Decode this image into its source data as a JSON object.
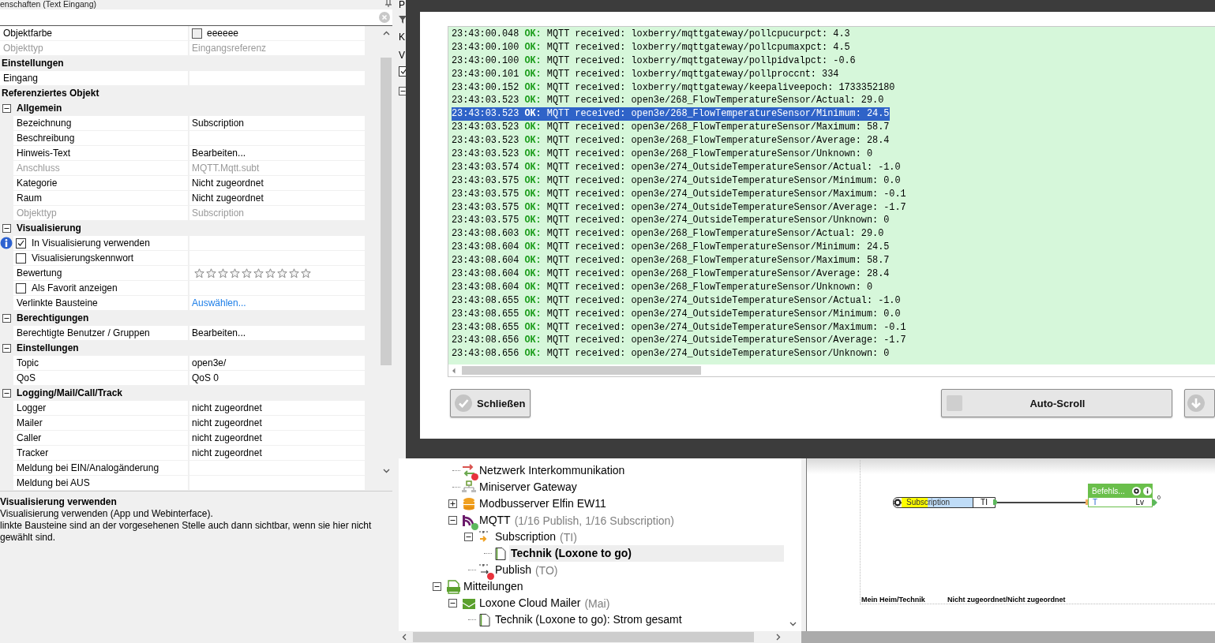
{
  "left_panel": {
    "title": "enschaften (Text Eingang)",
    "properties": [
      {
        "kind": "color",
        "label": "Objektfarbe",
        "value": "eeeeee",
        "disabled": false
      },
      {
        "kind": "prop",
        "label": "Objekttyp",
        "value": "Eingangsreferenz",
        "disabled": true
      },
      {
        "kind": "category",
        "label": "Einstellungen"
      },
      {
        "kind": "prop",
        "label": "Eingang",
        "disabled": false
      },
      {
        "kind": "category",
        "label": "Referenziertes Objekt"
      },
      {
        "kind": "group",
        "label": "Allgemein",
        "expanded": true,
        "children": [
          {
            "kind": "prop",
            "label": "Bezeichnung",
            "value": "Subscription",
            "disabled": false
          },
          {
            "kind": "prop",
            "label": "Beschreibung",
            "disabled": false
          },
          {
            "kind": "prop",
            "label": "Hinweis-Text",
            "value": "Bearbeiten...",
            "disabled": false
          },
          {
            "kind": "prop",
            "label": "Anschluss",
            "value": "MQTT.Mqtt.subt",
            "disabled": true
          },
          {
            "kind": "prop",
            "label": "Kategorie",
            "value": "Nicht zugeordnet",
            "disabled": false
          },
          {
            "kind": "prop",
            "label": "Raum",
            "value": "Nicht zugeordnet",
            "disabled": false
          },
          {
            "kind": "prop",
            "label": "Objekttyp",
            "value": "Subscription",
            "disabled": true
          }
        ]
      },
      {
        "kind": "group",
        "label": "Visualisierung",
        "expanded": true,
        "children": [
          {
            "kind": "check",
            "label": "In Visualisierung verwenden",
            "checked": true,
            "info": true
          },
          {
            "kind": "check",
            "label": "Visualisierungskennwort",
            "checked": false,
            "info": false
          },
          {
            "kind": "stars",
            "label": "Bewertung",
            "stars": 0
          },
          {
            "kind": "check",
            "label": "Als Favorit anzeigen",
            "checked": false,
            "info": false
          },
          {
            "kind": "link",
            "label": "Verlinkte Bausteine",
            "value": "Auswählen..."
          }
        ]
      },
      {
        "kind": "group",
        "label": "Berechtigungen",
        "expanded": true,
        "children": [
          {
            "kind": "prop",
            "label": "Berechtigte Benutzer / Gruppen",
            "value": "Bearbeiten...",
            "disabled": false
          }
        ]
      },
      {
        "kind": "group",
        "label": "Einstellungen",
        "expanded": true,
        "children": [
          {
            "kind": "prop",
            "label": "Topic",
            "value": "open3e/",
            "disabled": false
          },
          {
            "kind": "prop",
            "label": "QoS",
            "value": "QoS 0",
            "disabled": false
          }
        ]
      },
      {
        "kind": "group",
        "label": "Logging/Mail/Call/Track",
        "expanded": true,
        "children": [
          {
            "kind": "prop",
            "label": "Logger",
            "value": "nicht zugeordnet",
            "disabled": false
          },
          {
            "kind": "prop",
            "label": "Mailer",
            "value": "nicht zugeordnet",
            "disabled": false
          },
          {
            "kind": "prop",
            "label": "Caller",
            "value": "nicht zugeordnet",
            "disabled": false
          },
          {
            "kind": "prop",
            "label": "Tracker",
            "value": "nicht zugeordnet",
            "disabled": false
          },
          {
            "kind": "prop",
            "label": "Meldung bei EIN/Analogänderung",
            "disabled": false
          },
          {
            "kind": "prop",
            "label": "Meldung bei AUS",
            "disabled": false
          }
        ]
      }
    ],
    "description": {
      "title": "Visualisierung verwenden",
      "paragraphs": [
        "Visualisierung verwenden (App und Webinterface).",
        "linkte Bausteine sind an der vorgesehenen Stelle auch dann sichtbar, wenn sie hier nicht gewählt sind."
      ]
    }
  },
  "side_strip": [
    {
      "kind": "text",
      "label": "P"
    },
    {
      "kind": "filter"
    },
    {
      "kind": "text",
      "label": "K"
    },
    {
      "kind": "text",
      "label": "V"
    },
    {
      "kind": "checkbox",
      "checked": true
    },
    {
      "kind": "toggle"
    }
  ],
  "tree": [
    {
      "children": [
        {
          "label": "Netzwerk Interkommunikation",
          "kind": "arrows",
          "color": "#e8323c",
          "selected": false
        },
        {
          "label": "Miniserver Gateway",
          "kind": "gateway",
          "selected": false
        },
        {
          "label": "Modbusserver Elfin EW11",
          "kind": "database",
          "expanded": false,
          "selected": false
        },
        {
          "label": "MQTT",
          "note": "(1/16 Publish, 1/16 Subscription)",
          "kind": "signal",
          "color": "#5cb85c",
          "expanded": true,
          "selected": false,
          "children": [
            {
              "label": "Subscription",
              "note": "(TI)",
              "kind": "text-in",
              "expanded": true,
              "selected": false,
              "children": [
                {
                  "label": "Technik (Loxone to go)",
                  "kind": "page",
                  "selected": true
                }
              ]
            },
            {
              "label": "Publish",
              "note": "(TO)",
              "kind": "text-out",
              "color": "#e8323c",
              "selected": false
            }
          ]
        }
      ]
    },
    {
      "label": "Mitteilungen",
      "kind": "log",
      "expanded": true,
      "selected": false,
      "children": [
        {
          "label": "Loxone Cloud Mailer",
          "note": "(Mai)",
          "kind": "mail",
          "expanded": true,
          "selected": false,
          "children": [
            {
              "label": "Technik (Loxone to go): Strom gesamt",
              "kind": "page",
              "selected": false
            }
          ]
        }
      ]
    }
  ],
  "diagram": {
    "input_block": {
      "label": "Subscription",
      "port": "TI"
    },
    "function_block": {
      "title": "Befehls...",
      "input": "T",
      "output": "Lv",
      "output_value": "0"
    },
    "footer": [
      "Mein Heim/Technik",
      "Nicht zugeordnet/Nicht zugeordnet"
    ]
  },
  "log_dialog": {
    "lines": [
      {
        "time": "23:43:00.048",
        "status": "OK:",
        "message": "MQTT received: loxberry/mqttgateway/pollcpucurpct: 4.3",
        "selected": false
      },
      {
        "time": "23:43:00.100",
        "status": "OK:",
        "message": "MQTT received: loxberry/mqttgateway/pollcpumaxpct: 4.5",
        "selected": false
      },
      {
        "time": "23:43:00.100",
        "status": "OK:",
        "message": "MQTT received: loxberry/mqttgateway/pollpidvalpct: -0.6",
        "selected": false
      },
      {
        "time": "23:43:00.101",
        "status": "OK:",
        "message": "MQTT received: loxberry/mqttgateway/pollproccnt: 334",
        "selected": false
      },
      {
        "time": "23:43:00.152",
        "status": "OK:",
        "message": "MQTT received: loxberry/mqttgateway/keepaliveepoch: 1733352180",
        "selected": false
      },
      {
        "time": "23:43:03.523",
        "status": "OK:",
        "message": "MQTT received: open3e/268_FlowTemperatureSensor/Actual: 29.0",
        "selected": false
      },
      {
        "time": "23:43:03.523",
        "status": "OK:",
        "message": "MQTT received: open3e/268_FlowTemperatureSensor/Minimum: 24.5",
        "selected": true
      },
      {
        "time": "23:43:03.523",
        "status": "OK:",
        "message": "MQTT received: open3e/268_FlowTemperatureSensor/Maximum: 58.7",
        "selected": false
      },
      {
        "time": "23:43:03.523",
        "status": "OK:",
        "message": "MQTT received: open3e/268_FlowTemperatureSensor/Average: 28.4",
        "selected": false
      },
      {
        "time": "23:43:03.523",
        "status": "OK:",
        "message": "MQTT received: open3e/268_FlowTemperatureSensor/Unknown: 0",
        "selected": false
      },
      {
        "time": "23:43:03.574",
        "status": "OK:",
        "message": "MQTT received: open3e/274_OutsideTemperatureSensor/Actual: -1.0",
        "selected": false
      },
      {
        "time": "23:43:03.575",
        "status": "OK:",
        "message": "MQTT received: open3e/274_OutsideTemperatureSensor/Minimum: 0.0",
        "selected": false
      },
      {
        "time": "23:43:03.575",
        "status": "OK:",
        "message": "MQTT received: open3e/274_OutsideTemperatureSensor/Maximum: -0.1",
        "selected": false
      },
      {
        "time": "23:43:03.575",
        "status": "OK:",
        "message": "MQTT received: open3e/274_OutsideTemperatureSensor/Average: -1.7",
        "selected": false
      },
      {
        "time": "23:43:03.575",
        "status": "OK:",
        "message": "MQTT received: open3e/274_OutsideTemperatureSensor/Unknown: 0",
        "selected": false
      },
      {
        "time": "23:43:08.603",
        "status": "OK:",
        "message": "MQTT received: open3e/268_FlowTemperatureSensor/Actual: 29.0",
        "selected": false
      },
      {
        "time": "23:43:08.604",
        "status": "OK:",
        "message": "MQTT received: open3e/268_FlowTemperatureSensor/Minimum: 24.5",
        "selected": false
      },
      {
        "time": "23:43:08.604",
        "status": "OK:",
        "message": "MQTT received: open3e/268_FlowTemperatureSensor/Maximum: 58.7",
        "selected": false
      },
      {
        "time": "23:43:08.604",
        "status": "OK:",
        "message": "MQTT received: open3e/268_FlowTemperatureSensor/Average: 28.4",
        "selected": false
      },
      {
        "time": "23:43:08.604",
        "status": "OK:",
        "message": "MQTT received: open3e/268_FlowTemperatureSensor/Unknown: 0",
        "selected": false
      },
      {
        "time": "23:43:08.655",
        "status": "OK:",
        "message": "MQTT received: open3e/274_OutsideTemperatureSensor/Actual: -1.0",
        "selected": false
      },
      {
        "time": "23:43:08.655",
        "status": "OK:",
        "message": "MQTT received: open3e/274_OutsideTemperatureSensor/Minimum: 0.0",
        "selected": false
      },
      {
        "time": "23:43:08.655",
        "status": "OK:",
        "message": "MQTT received: open3e/274_OutsideTemperatureSensor/Maximum: -0.1",
        "selected": false
      },
      {
        "time": "23:43:08.656",
        "status": "OK:",
        "message": "MQTT received: open3e/274_OutsideTemperatureSensor/Average: -1.7",
        "selected": false
      },
      {
        "time": "23:43:08.656",
        "status": "OK:",
        "message": "MQTT received: open3e/274_OutsideTemperatureSensor/Unknown: 0",
        "selected": false
      }
    ],
    "close_button": "Schließen",
    "auto_scroll": {
      "label": "Auto-Scroll",
      "checked": false
    }
  }
}
